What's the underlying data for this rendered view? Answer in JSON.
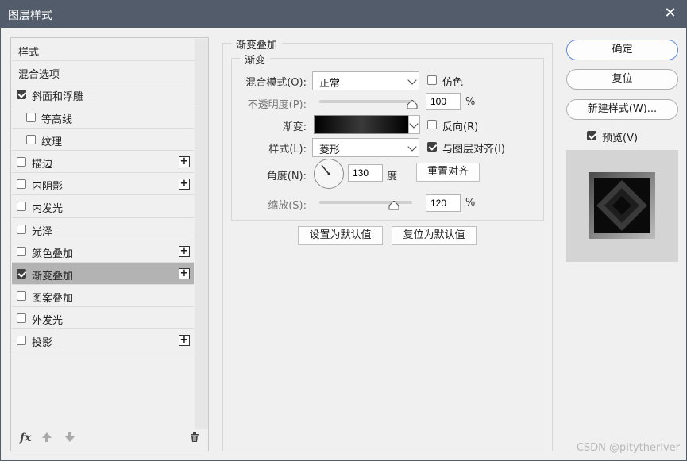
{
  "window": {
    "title": "图层样式"
  },
  "style_list": {
    "items": [
      {
        "label": "样式",
        "checkbox": false,
        "checked": false,
        "plus": false,
        "indent": false,
        "selected": false
      },
      {
        "label": "混合选项",
        "checkbox": false,
        "checked": false,
        "plus": false,
        "indent": false,
        "selected": false
      },
      {
        "label": "斜面和浮雕",
        "checkbox": true,
        "checked": true,
        "plus": false,
        "indent": false,
        "selected": false
      },
      {
        "label": "等高线",
        "checkbox": true,
        "checked": false,
        "plus": false,
        "indent": true,
        "selected": false
      },
      {
        "label": "纹理",
        "checkbox": true,
        "checked": false,
        "plus": false,
        "indent": true,
        "selected": false
      },
      {
        "label": "描边",
        "checkbox": true,
        "checked": false,
        "plus": true,
        "indent": false,
        "selected": false
      },
      {
        "label": "内阴影",
        "checkbox": true,
        "checked": false,
        "plus": true,
        "indent": false,
        "selected": false
      },
      {
        "label": "内发光",
        "checkbox": true,
        "checked": false,
        "plus": false,
        "indent": false,
        "selected": false
      },
      {
        "label": "光泽",
        "checkbox": true,
        "checked": false,
        "plus": false,
        "indent": false,
        "selected": false
      },
      {
        "label": "颜色叠加",
        "checkbox": true,
        "checked": false,
        "plus": true,
        "indent": false,
        "selected": false
      },
      {
        "label": "渐变叠加",
        "checkbox": true,
        "checked": true,
        "plus": true,
        "indent": false,
        "selected": true
      },
      {
        "label": "图案叠加",
        "checkbox": true,
        "checked": false,
        "plus": false,
        "indent": false,
        "selected": false
      },
      {
        "label": "外发光",
        "checkbox": true,
        "checked": false,
        "plus": false,
        "indent": false,
        "selected": false
      },
      {
        "label": "投影",
        "checkbox": true,
        "checked": false,
        "plus": true,
        "indent": false,
        "selected": false
      }
    ],
    "bottom": {
      "fx": "fx",
      "up_icon": "arrow-up-icon",
      "down_icon": "arrow-down-icon",
      "trash_icon": "trash-icon"
    }
  },
  "gradient_overlay": {
    "section_title": "渐变叠加",
    "group_title": "渐变",
    "blend_mode": {
      "label": "混合模式(O):",
      "value": "正常"
    },
    "opacity": {
      "label": "不透明度(P):",
      "value": "100",
      "unit": "%",
      "fraction": 1.0
    },
    "gradient": {
      "label": "渐变:"
    },
    "reverse": {
      "label": "反向(R)",
      "checked": false
    },
    "dither": {
      "label": "仿色",
      "checked": false
    },
    "style": {
      "label": "样式(L):",
      "value": "菱形"
    },
    "align_layer": {
      "label": "与图层对齐(I)",
      "checked": true
    },
    "angle": {
      "label": "角度(N):",
      "value": "130",
      "unit": "度",
      "degrees": 130
    },
    "reset_align_button": "重置对齐",
    "scale": {
      "label": "缩放(S):",
      "value": "120",
      "unit": "%",
      "fraction": 0.8
    },
    "set_default_button": "设置为默认值",
    "reset_default_button": "复位为默认值"
  },
  "right_panel": {
    "ok_button": "确定",
    "reset_button": "复位",
    "new_style_button": "新建样式(W)...",
    "preview": {
      "label": "预览(V)",
      "checked": true
    }
  },
  "watermark": "CSDN @pitytheriver",
  "colors": {
    "titlebar": "#535c6b",
    "selected_row": "#b3b3b3",
    "accent": "#5b8cd6"
  }
}
